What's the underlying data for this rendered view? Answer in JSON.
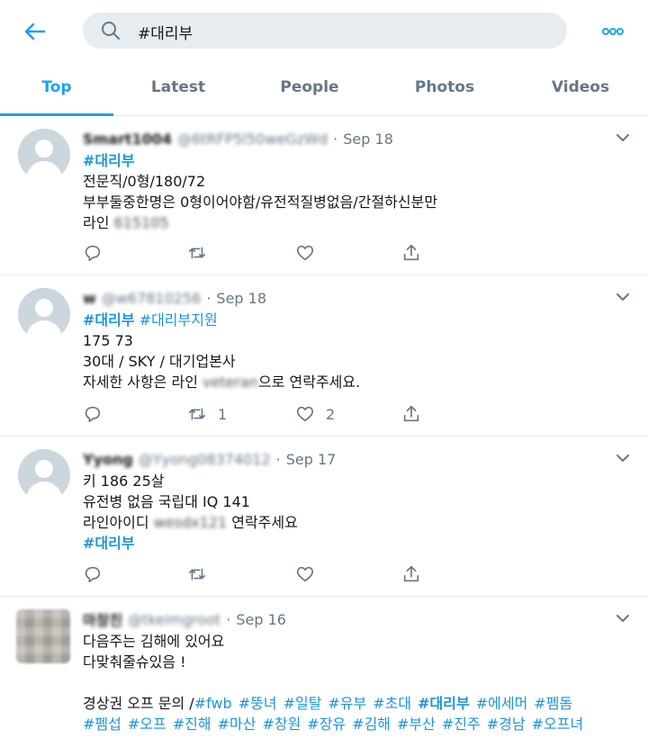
{
  "search": {
    "query": "#대리부"
  },
  "tabs": [
    {
      "label": "Top",
      "active": true
    },
    {
      "label": "Latest"
    },
    {
      "label": "People"
    },
    {
      "label": "Photos"
    },
    {
      "label": "Videos"
    }
  ],
  "colors": {
    "accent": "#1da1f2",
    "hashtag": "#1b95e0",
    "secondary": "#657786",
    "divider": "#e6ecf0"
  },
  "tweets": [
    {
      "name": "Smart1004",
      "handle": "@6tRFP5l50weGzWd",
      "date": "Sep 18",
      "hashtag": "#대리부",
      "line1": "전문직/0형/180/72",
      "line2": "부부둘중한명은 0형이어야함/유전적질병없음/간절하신분만",
      "line3_prefix": "라인",
      "line3_blur": "615105",
      "reply_count": "",
      "retweet_count": "",
      "like_count": ""
    },
    {
      "name": "w",
      "handle": "@w67810256",
      "date": "Sep 18",
      "hashtag": "#대리부",
      "hashtag2": "#대리부지원",
      "line1": "175 73",
      "line2": "30대 / SKY / 대기업본사",
      "line3_prefix": "자세한 사항은 라인",
      "line3_blur": "veteran",
      "line3_suffix": "으로 연락주세요.",
      "retweet_count": "1",
      "like_count": "2"
    },
    {
      "name": "Yyong",
      "handle": "@Yyong08374012",
      "date": "Sep 17",
      "line1": "키 186 25살",
      "line2": "유전병 없음 국립대 IQ 141",
      "line3_prefix": "라인아이디",
      "line3_blur": "wesdx121",
      "line3_suffix": "연락주세요",
      "hashtag": "#대리부"
    },
    {
      "name": "마창친",
      "handle": "@tkeimgroot",
      "date": "Sep 16",
      "line1": "다음주는 김해에 있어요",
      "line2": "다맞춰줄슈있음 !",
      "line4_prefix": "경상권 오프 문의 /",
      "tags_row1": [
        "#fwb",
        "#뚱녀",
        "#일탈",
        "#유부",
        "#초대",
        "#대리부",
        "#에세머",
        "#펨돔"
      ],
      "tags_row2": [
        "#펨섭",
        "#오프",
        "#진해",
        "#마산",
        "#창원",
        "#장유",
        "#김해",
        "#부산",
        "#진주",
        "#경남",
        "#오프녀"
      ]
    }
  ],
  "icons": {
    "back": "arrow-left-icon",
    "search": "search-icon",
    "more": "more-dots-icon",
    "chevron": "chevron-down-icon",
    "reply": "reply-icon",
    "retweet": "retweet-icon",
    "like": "heart-icon",
    "share": "share-icon"
  }
}
